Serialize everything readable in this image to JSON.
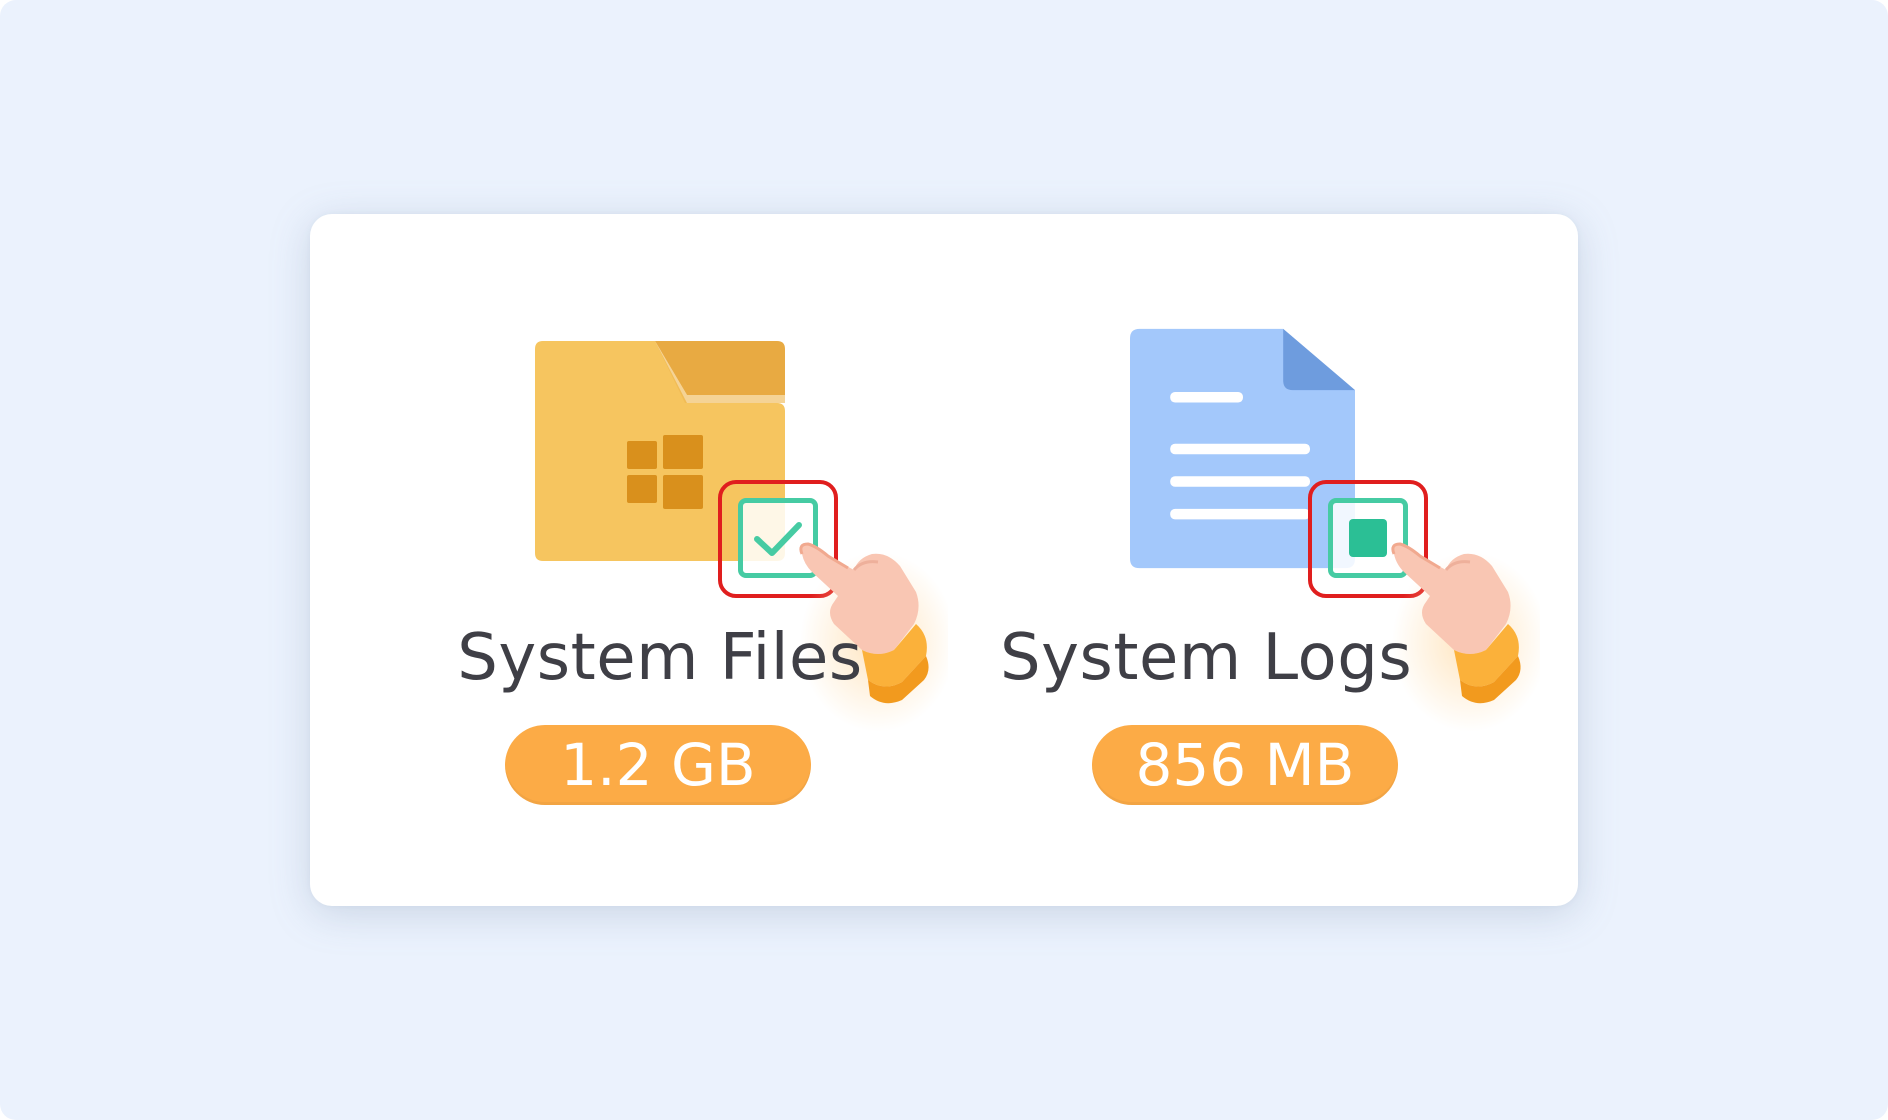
{
  "items": [
    {
      "label": "System Files",
      "size": "1.2 GB",
      "icon": "windows-folder-icon",
      "checkbox_state": "checked"
    },
    {
      "label": "System Logs",
      "size": "856 MB",
      "icon": "document-icon",
      "checkbox_state": "indeterminate"
    }
  ],
  "colors": {
    "background": "#ebf2fd",
    "folder": "#f6c55f",
    "folder_tab": "#e8aa42",
    "windows_logo": "#d9901c",
    "document": "#a3c8fb",
    "document_fold": "#6e9cde",
    "checkbox": "#46cba3",
    "highlight_border": "#e01e1e",
    "size_badge": "#fcab46"
  }
}
